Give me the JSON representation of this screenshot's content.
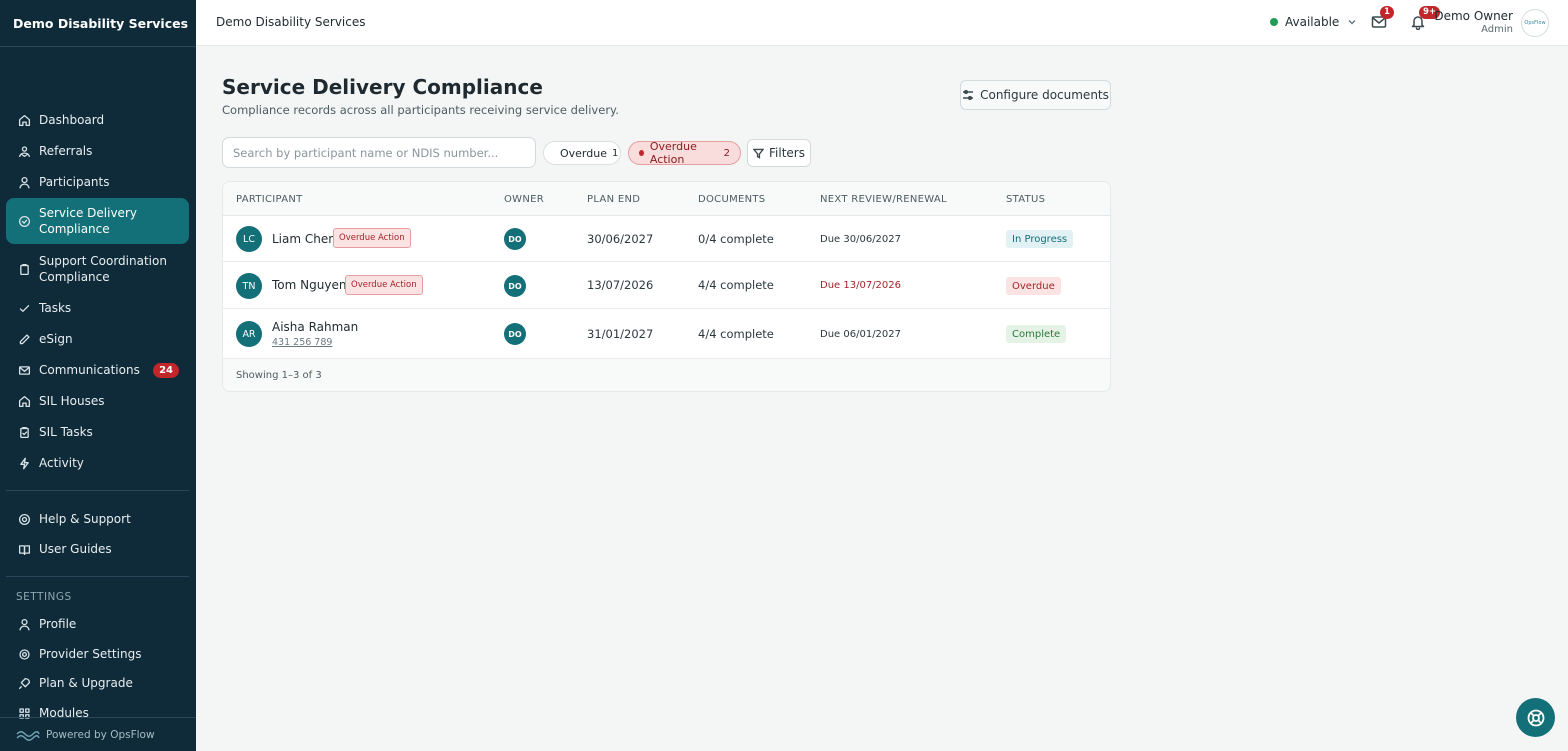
{
  "sidebar": {
    "org_name": "Demo Disability Services",
    "items": [
      {
        "label": "Dashboard",
        "icon": "home-icon"
      },
      {
        "label": "Referrals",
        "icon": "handshake-icon"
      },
      {
        "label": "Participants",
        "icon": "user-icon"
      },
      {
        "label": "Service Delivery Compliance",
        "icon": "check-circle-icon",
        "active": true
      },
      {
        "label": "Support Coordination Compliance",
        "icon": "clipboard-icon"
      },
      {
        "label": "Tasks",
        "icon": "check-icon"
      },
      {
        "label": "eSign",
        "icon": "pen-icon"
      },
      {
        "label": "Communications",
        "icon": "mail-icon",
        "badge": "24"
      },
      {
        "label": "SIL Houses",
        "icon": "house-icon"
      },
      {
        "label": "SIL Tasks",
        "icon": "clipboard-check-icon"
      },
      {
        "label": "Activity",
        "icon": "bolt-icon"
      }
    ],
    "support_items": [
      {
        "label": "Help & Support",
        "icon": "lifebuoy-icon"
      },
      {
        "label": "User Guides",
        "icon": "book-icon"
      }
    ],
    "settings_heading": "SETTINGS",
    "settings_items": [
      {
        "label": "Profile",
        "icon": "user-icon"
      },
      {
        "label": "Provider Settings",
        "icon": "gear-icon"
      },
      {
        "label": "Plan & Upgrade",
        "icon": "rocket-icon"
      },
      {
        "label": "Modules",
        "icon": "grid-icon"
      }
    ],
    "footer": "Powered by OpsFlow"
  },
  "topbar": {
    "title": "Demo Disability Services",
    "availability": "Available",
    "mail_badge": "1",
    "notif_badge": "9+",
    "user_name": "Demo Owner",
    "user_role": "Admin",
    "logo_text": "OpsFlow"
  },
  "page": {
    "title": "Service Delivery Compliance",
    "subtitle": "Compliance records across all participants receiving service delivery.",
    "configure_label": "Configure documents",
    "search_placeholder": "Search by participant name or NDIS number...",
    "chip_overdue": {
      "label": "Overdue",
      "count": "1"
    },
    "chip_action": {
      "label": "Overdue Action",
      "count": "2"
    },
    "filters_label": "Filters"
  },
  "table": {
    "headers": [
      "PARTICIPANT",
      "OWNER",
      "PLAN END",
      "DOCUMENTS",
      "NEXT REVIEW/RENEWAL",
      "STATUS"
    ],
    "rows": [
      {
        "initials": "LC",
        "name": "Liam Chen",
        "tag": "Overdue Action",
        "ndis": "",
        "owner": "DO",
        "plan_end": "30/06/2027",
        "documents": "0/4 complete",
        "next_review": "Due 30/06/2027",
        "review_overdue": false,
        "status": "In Progress"
      },
      {
        "initials": "TN",
        "name": "Tom Nguyen",
        "tag": "Overdue Action",
        "ndis": "",
        "owner": "DO",
        "plan_end": "13/07/2026",
        "documents": "4/4 complete",
        "next_review": "Due 13/07/2026",
        "review_overdue": true,
        "status": "Overdue"
      },
      {
        "initials": "AR",
        "name": "Aisha Rahman",
        "tag": "",
        "ndis": "431 256 789",
        "owner": "DO",
        "plan_end": "31/01/2027",
        "documents": "4/4 complete",
        "next_review": "Due 06/01/2027",
        "review_overdue": false,
        "status": "Complete"
      }
    ],
    "footer": "Showing 1–3 of 3"
  },
  "colors": {
    "sidebar_bg": "#0f2b3a",
    "accent": "#136f78",
    "danger": "#c0262a",
    "available": "#1f9d55"
  }
}
